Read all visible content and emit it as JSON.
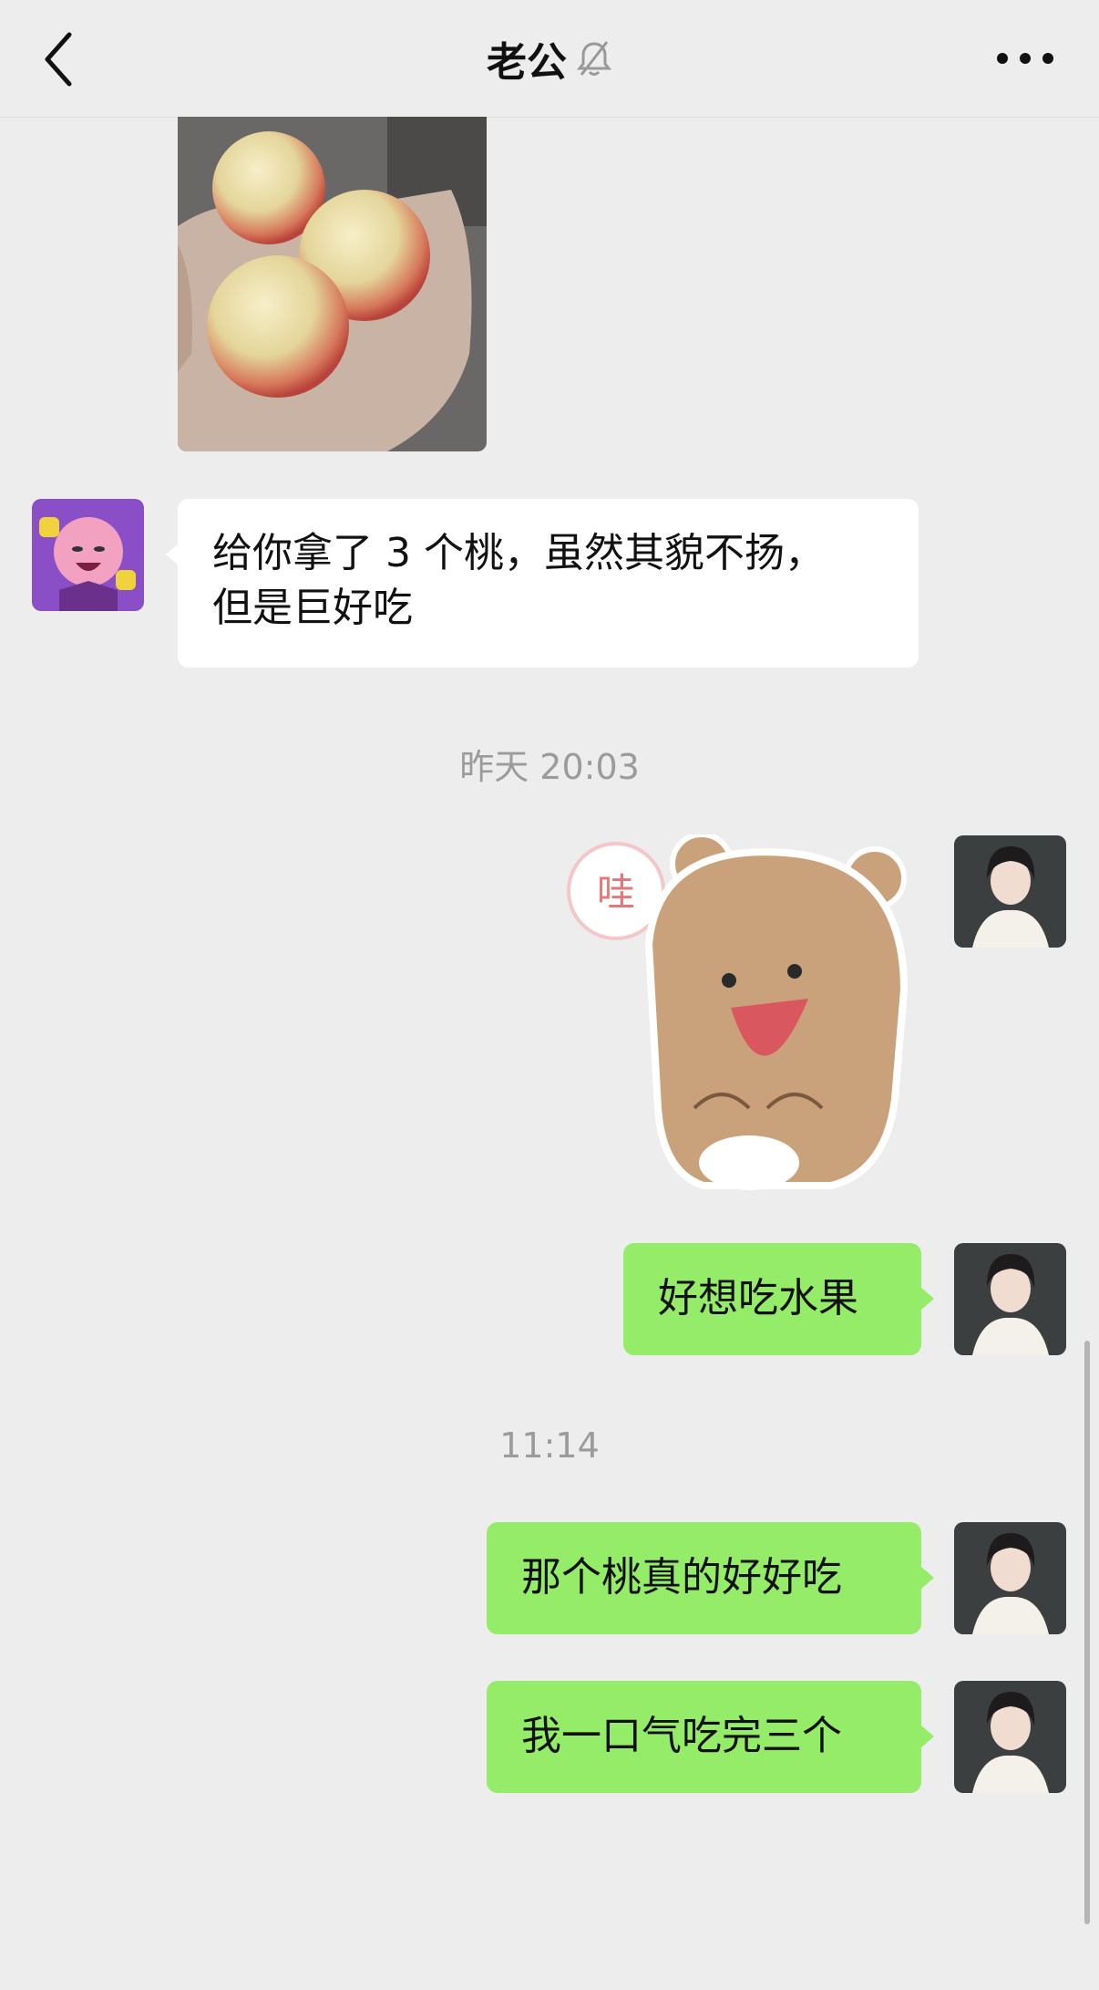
{
  "header": {
    "title": "老公",
    "back_icon": "chevron-left-icon",
    "mute_icon": "bell-off-icon",
    "more_icon": "more-horizontal-icon"
  },
  "messages": {
    "m1_text_line1": "给你拿了 3 个桃，虽然其貌不扬，",
    "m1_text_line2": "但是巨好吃",
    "timestamp1": "昨天 20:03",
    "sticker_text": "哇",
    "m2_text": "好想吃水果",
    "timestamp2": "11:14",
    "m3_text": "那个桃真的好好吃",
    "m4_text": "我一口气吃完三个"
  },
  "colors": {
    "background": "#ededed",
    "sent_bubble": "#95ec69",
    "received_bubble": "#ffffff",
    "timestamp": "#9b9b9b"
  }
}
